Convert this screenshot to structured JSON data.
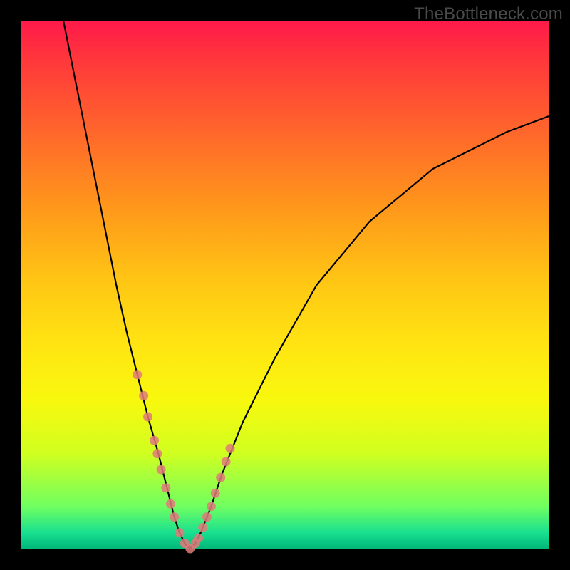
{
  "watermark": "TheBottleneck.com",
  "chart_data": {
    "type": "line",
    "title": "",
    "xlabel": "",
    "ylabel": "",
    "xlim": [
      0,
      100
    ],
    "ylim": [
      0,
      100
    ],
    "grid": false,
    "legend": false,
    "series": [
      {
        "name": "bottleneck-curve",
        "x": [
          8,
          10,
          12,
          14,
          16,
          18,
          20,
          22,
          24,
          26,
          27,
          28,
          29,
          30,
          31,
          32,
          33,
          34,
          36,
          38,
          42,
          48,
          56,
          66,
          78,
          92,
          100
        ],
        "values": [
          100,
          90,
          80,
          70,
          60,
          50,
          41,
          33,
          25,
          18,
          14,
          10,
          6,
          3,
          1,
          0,
          1,
          3,
          8,
          14,
          24,
          36,
          50,
          62,
          72,
          79,
          82
        ]
      }
    ],
    "markers": {
      "name": "highlighted-points",
      "x": [
        22.0,
        23.2,
        24.0,
        25.2,
        25.8,
        26.5,
        27.4,
        28.3,
        29.0,
        30.0,
        31.0,
        32.0,
        33.0,
        33.6,
        34.4,
        35.2,
        36.0,
        36.8,
        37.8,
        38.8,
        39.6
      ],
      "values": [
        33.0,
        29.0,
        25.0,
        20.5,
        18.0,
        15.0,
        11.5,
        8.5,
        6.0,
        3.0,
        1.0,
        0.0,
        1.0,
        2.0,
        4.0,
        6.0,
        8.0,
        10.5,
        13.5,
        16.5,
        19.0
      ]
    },
    "gradient_stops": [
      {
        "pos": 0,
        "color": "#ff1a4a"
      },
      {
        "pos": 8,
        "color": "#ff3a3a"
      },
      {
        "pos": 22,
        "color": "#ff6a2a"
      },
      {
        "pos": 36,
        "color": "#ff9a1a"
      },
      {
        "pos": 50,
        "color": "#ffc814"
      },
      {
        "pos": 62,
        "color": "#ffe612"
      },
      {
        "pos": 72,
        "color": "#f8f80e"
      },
      {
        "pos": 82,
        "color": "#d0ff20"
      },
      {
        "pos": 92,
        "color": "#70ff60"
      },
      {
        "pos": 97,
        "color": "#18e090"
      },
      {
        "pos": 100,
        "color": "#00b77a"
      }
    ],
    "curve_color": "#000000",
    "marker_color": "#e07a7a"
  }
}
